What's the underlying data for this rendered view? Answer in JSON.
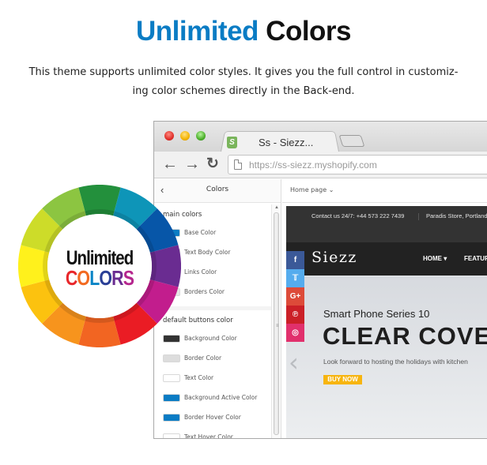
{
  "heading": {
    "accent": "Unlimited",
    "rest": " Colors"
  },
  "subtitle": "This theme supports unlimited color styles. It gives you the full control in customiz-ing color schemes directly in the Back-end.",
  "subtitle_lines": [
    "This theme supports unlimited color styles. It gives you the full control in customiz-",
    "ing color schemes directly in the Back-end."
  ],
  "colors": {
    "accent": "#0a7cc4",
    "heading": "#111111"
  },
  "browser": {
    "tab_title": "Ss - Siezz...",
    "tab_icon": "shopify-icon",
    "nav": {
      "back": "←",
      "forward": "→",
      "reload": "C"
    },
    "url": "https://ss-siezz.myshopify.com"
  },
  "sidebar": {
    "back": "‹",
    "title": "Colors",
    "sections": [
      {
        "title": "main colors",
        "items": [
          {
            "label": "Base Color",
            "color": "#0a7cc4"
          },
          {
            "label": "Text Body Color",
            "color": "#555555"
          },
          {
            "label": "Links Color",
            "color": "#0a7cc4"
          },
          {
            "label": "Borders Color",
            "color": "#e5e5e5"
          }
        ]
      },
      {
        "title": "default buttons color",
        "items": [
          {
            "label": "Background Color",
            "color": "#333333"
          },
          {
            "label": "Border Color",
            "color": "#dddddd"
          },
          {
            "label": "Text Color",
            "color": "#ffffff"
          },
          {
            "label": "Background Active Color",
            "color": "#0a7cc4"
          },
          {
            "label": "Border Hover Color",
            "color": "#0a7cc4"
          },
          {
            "label": "Text Hover Color",
            "color": "#ffffff"
          }
        ]
      }
    ]
  },
  "preview": {
    "page_select": "Home page ⌄",
    "contact": "Contact us 24/7: +44 573 222 7439",
    "store": "Paradis Store, Portland",
    "logo": "Siezz",
    "nav": [
      "HOME ▾",
      "FEATURES"
    ],
    "social": [
      "f",
      "🐦",
      "G+",
      "℗",
      "◎"
    ],
    "hero": {
      "prev": "‹",
      "subtitle": "Smart Phone Series 10",
      "title": "CLEAR COVER",
      "desc": "Look forward to hosting the holidays with kitchen",
      "button": "BUY NOW"
    }
  },
  "wheel": {
    "line1": "Unlimited",
    "line2_letters": [
      {
        "ch": "C",
        "color": "#e8262a"
      },
      {
        "ch": "O",
        "color": "#f26a21"
      },
      {
        "ch": "L",
        "color": "#0a84c6"
      },
      {
        "ch": "O",
        "color": "#2a3f96"
      },
      {
        "ch": "R",
        "color": "#6a2c91"
      },
      {
        "ch": "S",
        "color": "#b5268e"
      }
    ],
    "segments": [
      "#23903c",
      "#0e95b8",
      "#0756a8",
      "#6a2c91",
      "#c21d8d",
      "#ea1c24",
      "#f26522",
      "#f7941d",
      "#fcc20f",
      "#fff11c",
      "#cddc29",
      "#8cc541"
    ]
  }
}
